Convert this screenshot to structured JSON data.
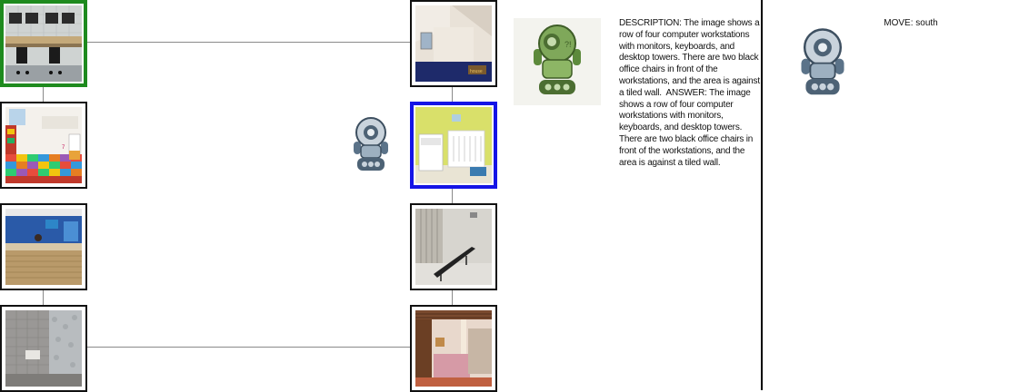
{
  "map": {
    "rooms": [
      {
        "id": "computer-lab",
        "state": "start"
      },
      {
        "id": "attic-bedroom",
        "state": "normal"
      },
      {
        "id": "playroom",
        "state": "normal"
      },
      {
        "id": "nursery",
        "state": "current"
      },
      {
        "id": "reception-desk",
        "state": "normal"
      },
      {
        "id": "locker-room",
        "state": "normal"
      },
      {
        "id": "shower-room",
        "state": "normal"
      },
      {
        "id": "basement",
        "state": "normal"
      }
    ],
    "agent_icon": "robot-icon"
  },
  "agent_panel": {
    "icon": "green-robot-icon",
    "description_text": "DESCRIPTION: The image shows a row of four computer workstations with monitors, keyboards, and desktop towers. There are two black office chairs in front of the workstations, and the area is against a tiled wall.  ANSWER: The image shows a row of four computer workstations with monitors, keyboards, and desktop towers. There are two black office chairs in front of the workstations, and the area is against a tiled wall."
  },
  "move_panel": {
    "icon": "robot-icon",
    "move_text": "MOVE: south"
  },
  "colors": {
    "start_border": "#1e8a1e",
    "current_border": "#1414e6",
    "edge": "#8a8a8a",
    "robot_blue": "#5b7389",
    "robot_green": "#6e9a4a"
  }
}
